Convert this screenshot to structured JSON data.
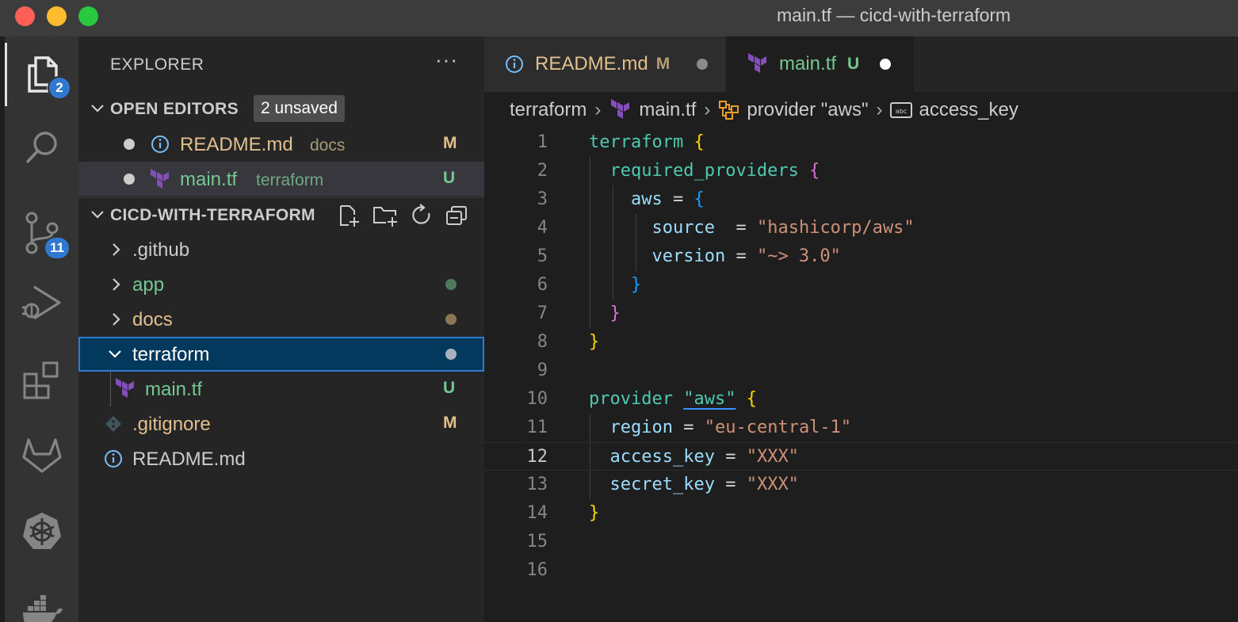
{
  "window": {
    "title": "main.tf — cicd-with-terraform"
  },
  "activity_bar": {
    "explorer_badge": "2",
    "scm_badge": "11"
  },
  "sidebar": {
    "header": "EXPLORER",
    "more": "···",
    "open_editors": {
      "label": "OPEN EDITORS",
      "unsaved_badge": "2 unsaved",
      "items": [
        {
          "name": "README.md",
          "folder": "docs",
          "status": "M"
        },
        {
          "name": "main.tf",
          "folder": "terraform",
          "status": "U"
        }
      ]
    },
    "project": {
      "label": "CICD-WITH-TERRAFORM",
      "tree": [
        {
          "name": ".github",
          "status": ""
        },
        {
          "name": "app",
          "status": ""
        },
        {
          "name": "docs",
          "status": ""
        },
        {
          "name": "terraform",
          "status": ""
        },
        {
          "name": "main.tf",
          "status": "U"
        },
        {
          "name": ".gitignore",
          "status": "M"
        },
        {
          "name": "README.md",
          "status": ""
        }
      ]
    }
  },
  "tabs": [
    {
      "name": "README.md",
      "status": "M"
    },
    {
      "name": "main.tf",
      "status": "U"
    }
  ],
  "breadcrumb": {
    "items": [
      "terraform",
      "main.tf",
      "provider \"aws\"",
      "access_key"
    ]
  },
  "editor": {
    "line_numbers": [
      "1",
      "2",
      "3",
      "4",
      "5",
      "6",
      "7",
      "8",
      "9",
      "10",
      "11",
      "12",
      "13",
      "14",
      "15",
      "16"
    ],
    "current_line": "12",
    "code": {
      "l1_kw": "terraform",
      "l2_kw": "required_providers",
      "l3_kw": "aws",
      "l4_key": "source",
      "l4_val": "\"hashicorp/aws\"",
      "l5_key": "version",
      "l5_val": "\"~> 3.0\"",
      "l10_kw": "provider",
      "l10_name": "\"aws\"",
      "l11_key": "region",
      "l11_val": "\"eu-central-1\"",
      "l12_key": "access_key",
      "l12_val": "\"XXX\"",
      "l13_key": "secret_key",
      "l13_val": "\"XXX\""
    }
  },
  "colors": {
    "modified": "#e2c08d",
    "untracked": "#73c991",
    "accent": "#2f79d1",
    "terraform": "#844fba"
  }
}
